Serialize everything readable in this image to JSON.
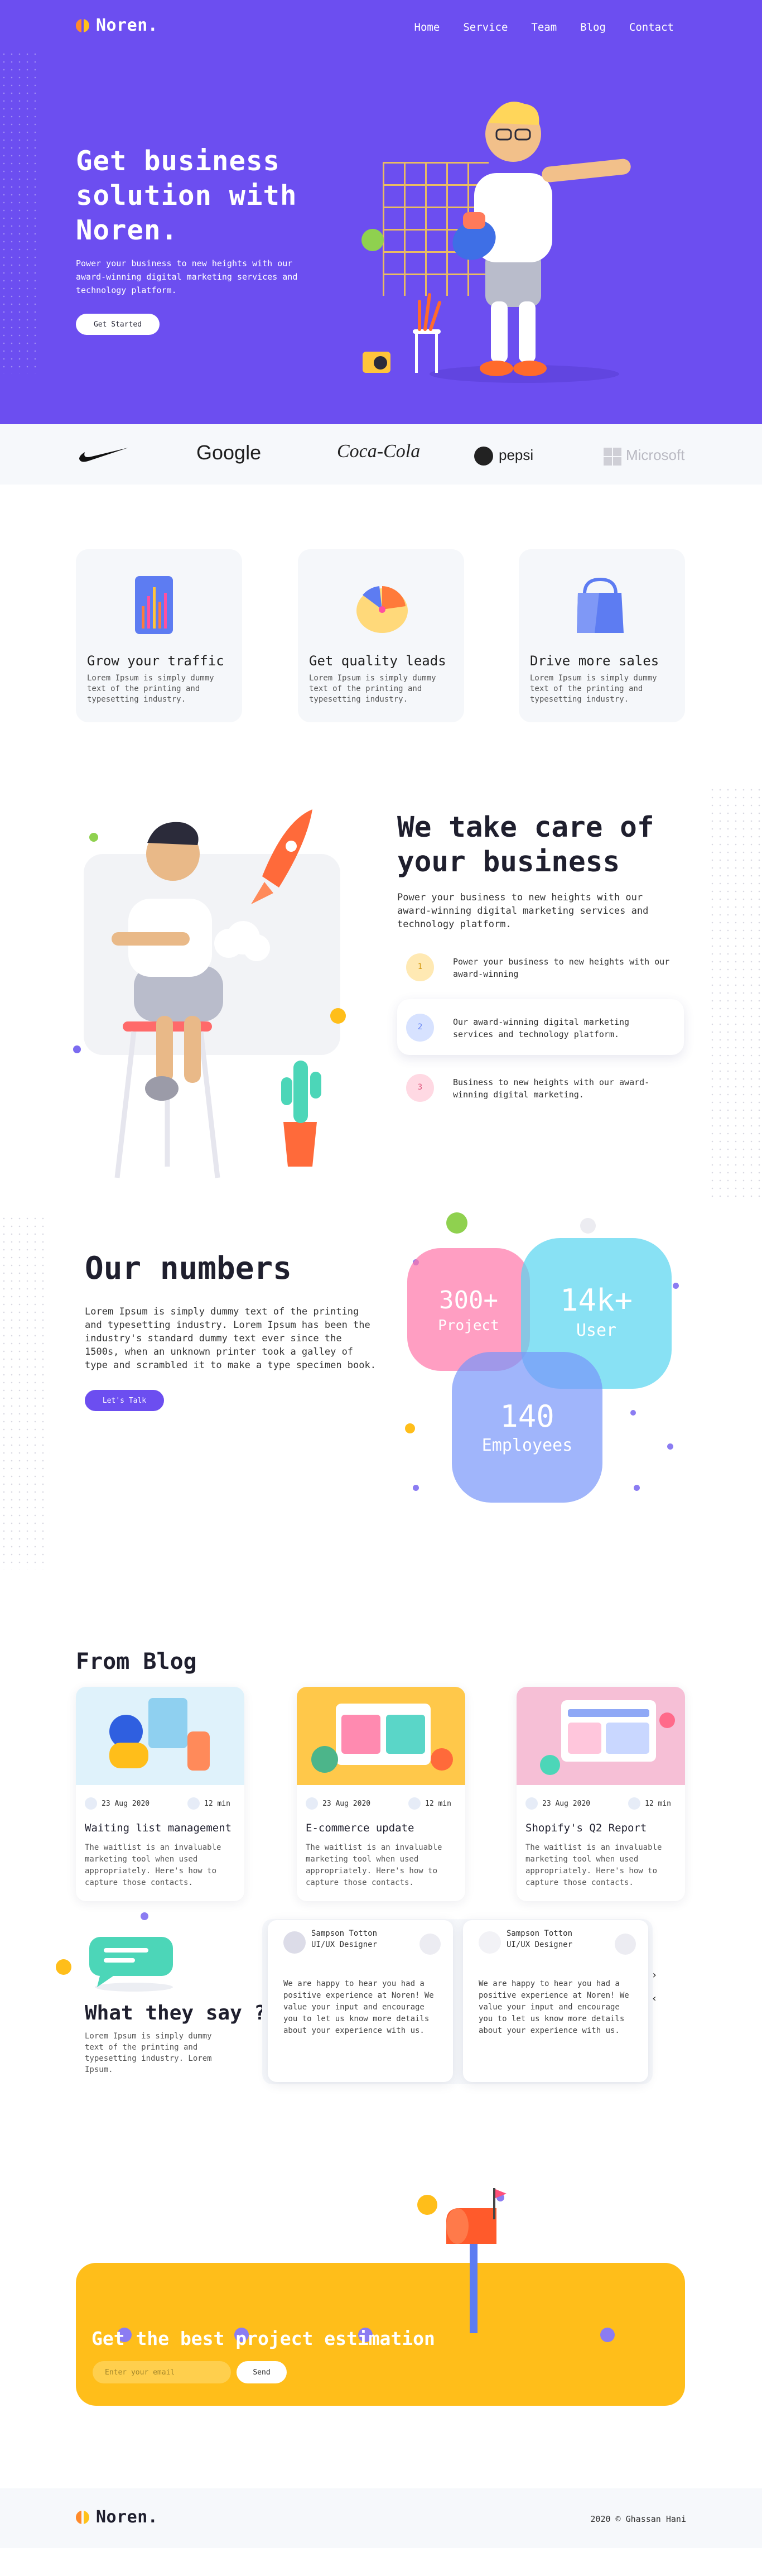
{
  "brand": {
    "name": "Noren."
  },
  "nav": {
    "items": [
      "Home",
      "Service",
      "Team",
      "Blog",
      "Contact"
    ]
  },
  "hero": {
    "title": "Get business solution with Noren.",
    "subtitle": "Power your business to new heights with our award-winning digital marketing services and technology platform.",
    "button": "Get Started"
  },
  "brands": {
    "items": [
      "Google",
      "Coca-Cola",
      "pepsi",
      "Microsoft"
    ]
  },
  "features": [
    {
      "title": "Grow your traffic",
      "text": "Lorem Ipsum is simply dummy text of the printing and typesetting industry."
    },
    {
      "title": "Get quality leads",
      "text": "Lorem Ipsum is simply dummy text of the printing and typesetting industry."
    },
    {
      "title": "Drive more sales",
      "text": "Lorem Ipsum is simply dummy text of the printing and typesetting industry."
    }
  ],
  "care": {
    "title": "We take care of your business",
    "subtitle": "Power your business to new heights with our award-winning digital marketing services and technology platform.",
    "items": [
      {
        "num": "1",
        "text": "Power your business to new heights with our award-winning"
      },
      {
        "num": "2",
        "text": "Our award-winning digital marketing services and technology platform."
      },
      {
        "num": "3",
        "text": "Business to new heights with our award-winning digital marketing."
      }
    ]
  },
  "numbers": {
    "title": "Our numbers",
    "text": "Lorem Ipsum is simply dummy text of the printing and typesetting industry. Lorem Ipsum has been the industry's standard dummy text ever since the 1500s, when an unknown printer took a galley of type and scrambled it to make a type specimen book.",
    "button": "Let's Talk",
    "stats": [
      {
        "value": "300+",
        "label": "Project"
      },
      {
        "value": "14k+",
        "label": "User"
      },
      {
        "value": "140",
        "label": "Employees"
      }
    ]
  },
  "blog": {
    "title": "From Blog",
    "posts": [
      {
        "date": "23 Aug 2020",
        "read": "12 min",
        "title": "Waiting list management",
        "text": "The waitlist is an invaluable marketing tool when used appropriately. Here's how to capture those contacts."
      },
      {
        "date": "23 Aug 2020",
        "read": "12 min",
        "title": "E-commerce update",
        "text": "The waitlist is an invaluable marketing tool when used appropriately. Here's how to capture those contacts."
      },
      {
        "date": "23 Aug 2020",
        "read": "12 min",
        "title": "Shopify's Q2 Report",
        "text": "The waitlist is an invaluable marketing tool when used appropriately. Here's how to capture those contacts."
      }
    ]
  },
  "testimonials": {
    "title": "What they say ?",
    "text": "Lorem Ipsum is simply dummy text of the printing and typesetting industry. Lorem Ipsum.",
    "items": [
      {
        "name": "Sampson Totton",
        "role": "UI/UX Designer",
        "text": "We are happy to hear you had a positive experience at Noren! We value your input and encourage you to let us know more details about your experience with us."
      },
      {
        "name": "Sampson Totton",
        "role": "UI/UX Designer",
        "text": "We are happy to hear you had a positive experience at Noren! We value your input and encourage you to let us know more details about your experience with us."
      }
    ]
  },
  "cta": {
    "title": "Get the best project estimation",
    "placeholder": "Enter your email",
    "button": "Send"
  },
  "footer": {
    "copyright": "2020 © Ghassan Hani"
  },
  "colors": {
    "primary": "#6c4ef0",
    "accent": "#ffbe1a",
    "soft": "#f5f7fa"
  }
}
